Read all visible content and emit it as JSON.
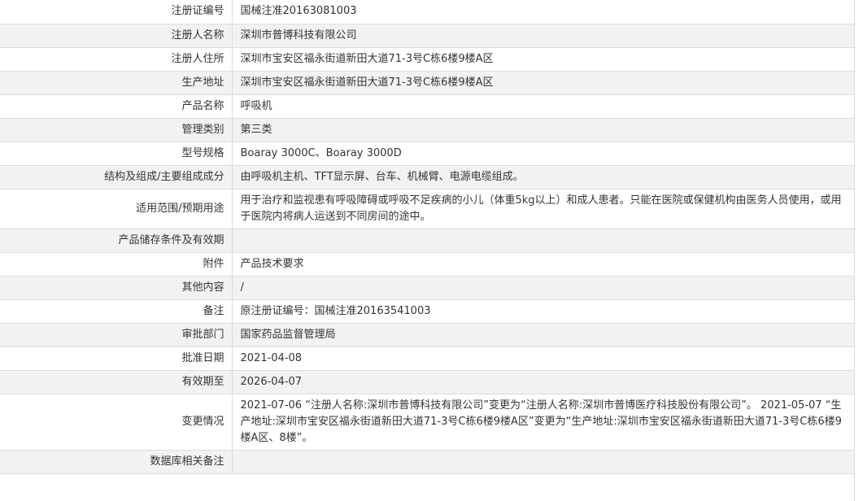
{
  "rows": [
    {
      "label": "注册证编号",
      "value": "国械注准20163081003"
    },
    {
      "label": "注册人名称",
      "value": "深圳市普博科技有限公司"
    },
    {
      "label": "注册人住所",
      "value": "深圳市宝安区福永街道新田大道71-3号C栋6楼9楼A区"
    },
    {
      "label": "生产地址",
      "value": "深圳市宝安区福永街道新田大道71-3号C栋6楼9楼A区"
    },
    {
      "label": "产品名称",
      "value": "呼吸机"
    },
    {
      "label": "管理类别",
      "value": "第三类"
    },
    {
      "label": "型号规格",
      "value": "Boaray 3000C、Boaray 3000D"
    },
    {
      "label": "结构及组成/主要组成成分",
      "value": "由呼吸机主机、TFT显示屏、台车、机械臂、电源电缆组成。"
    },
    {
      "label": "适用范围/预期用途",
      "value": "用于治疗和监视患有呼吸障碍或呼吸不足疾病的小儿（体重5kg以上）和成人患者。只能在医院或保健机构由医务人员使用，或用于医院内将病人运送到不同房间的途中。"
    },
    {
      "label": "产品储存条件及有效期",
      "value": ""
    },
    {
      "label": "附件",
      "value": "产品技术要求"
    },
    {
      "label": "其他内容",
      "value": "/"
    },
    {
      "label": "备注",
      "value": "原注册证编号：国械注准20163541003"
    },
    {
      "label": "审批部门",
      "value": "国家药品监督管理局"
    },
    {
      "label": "批准日期",
      "value": "2021-04-08"
    },
    {
      "label": "有效期至",
      "value": "2026-04-07"
    },
    {
      "label": "变更情况",
      "value": "2021-07-06 “注册人名称:深圳市普博科技有限公司”变更为“注册人名称:深圳市普博医疗科技股份有限公司”。 2021-05-07 “生产地址:深圳市宝安区福永街道新田大道71-3号C栋6楼9楼A区”变更为“生产地址:深圳市宝安区福永街道新田大道71-3号C栋6楼9楼A区、8楼”。"
    },
    {
      "label": "数据库相关备注",
      "value": ""
    }
  ]
}
